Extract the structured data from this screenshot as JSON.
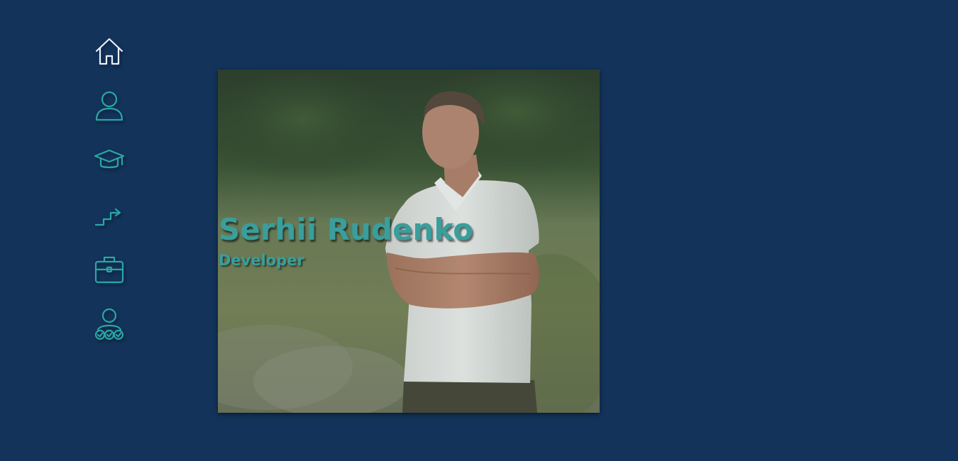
{
  "nav": {
    "items": [
      {
        "id": "home",
        "icon": "home-icon",
        "active": true
      },
      {
        "id": "about",
        "icon": "user-icon",
        "active": false
      },
      {
        "id": "education",
        "icon": "graduation-cap-icon",
        "active": false
      },
      {
        "id": "experience",
        "icon": "stairs-growth-icon",
        "active": false
      },
      {
        "id": "portfolio",
        "icon": "briefcase-icon",
        "active": false
      },
      {
        "id": "skills",
        "icon": "user-skills-icon",
        "active": false
      }
    ]
  },
  "hero": {
    "name": "Serhii Rudenko",
    "role": "Developer",
    "photo_alt": "person"
  },
  "colors": {
    "background": "#13335a",
    "accent": "#2aa6a5",
    "active_icon": "#e8f0ff",
    "name_text": "#3a9e9c"
  }
}
